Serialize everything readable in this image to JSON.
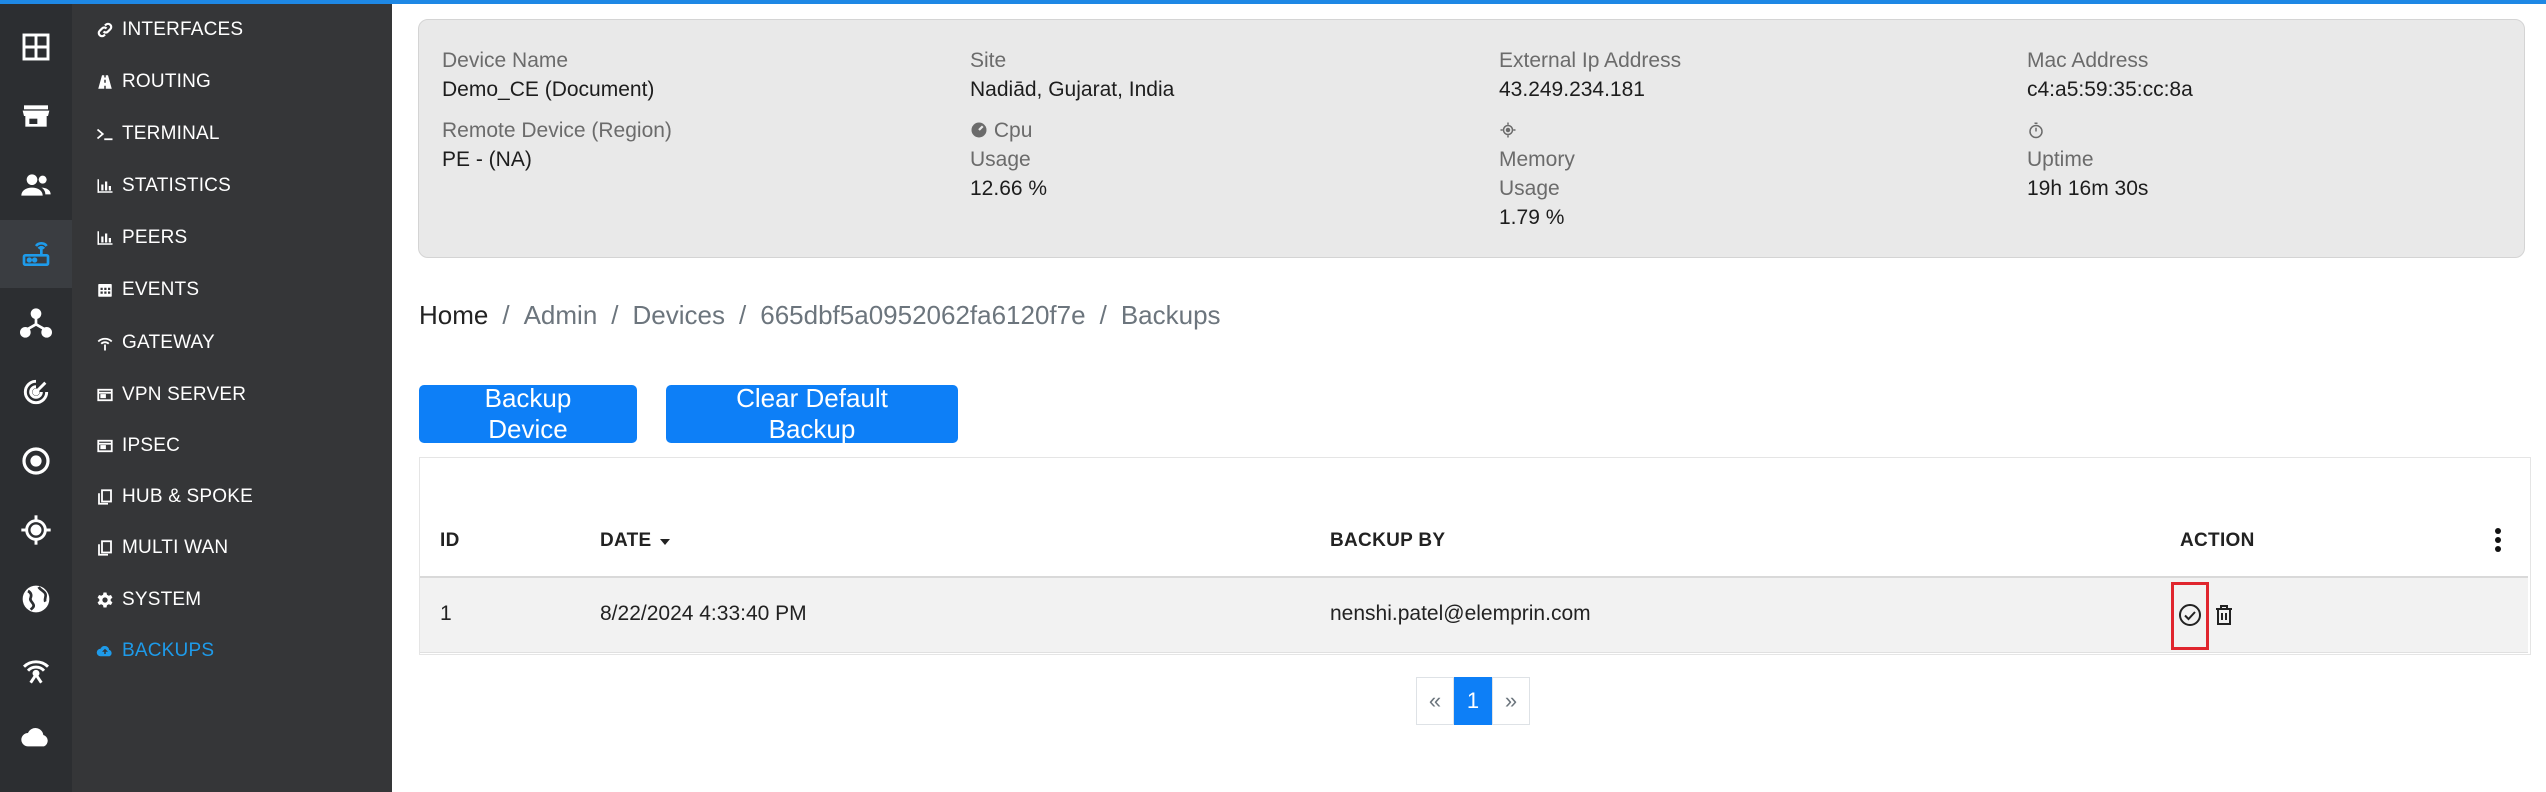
{
  "menu": {
    "items": [
      {
        "label": "INTERFACES",
        "icon": "link-icon"
      },
      {
        "label": "ROUTING",
        "icon": "road-icon"
      },
      {
        "label": "TERMINAL",
        "icon": "terminal-icon"
      },
      {
        "label": "STATISTICS",
        "icon": "bar-chart-icon"
      },
      {
        "label": "PEERS",
        "icon": "bar-chart-icon"
      },
      {
        "label": "EVENTS",
        "icon": "calendar-icon"
      },
      {
        "label": "GATEWAY",
        "icon": "antenna-icon"
      },
      {
        "label": "VPN SERVER",
        "icon": "window-icon"
      },
      {
        "label": "IPSEC",
        "icon": "window-icon"
      },
      {
        "label": "HUB & SPOKE",
        "icon": "copy-icon"
      },
      {
        "label": "MULTI WAN",
        "icon": "copy-icon"
      },
      {
        "label": "SYSTEM",
        "icon": "gear-icon"
      },
      {
        "label": "BACKUPS",
        "icon": "cloud-upload-icon"
      }
    ],
    "active": "BACKUPS"
  },
  "rail": {
    "icons": [
      "dashboard-grid-icon",
      "store-icon",
      "users-icon",
      "router-icon",
      "network-icon",
      "radar-icon",
      "target-icon",
      "crosshair-icon",
      "globe-icon",
      "wireless-tower-icon",
      "cloud-icon"
    ],
    "active_index": 3
  },
  "device_info": {
    "device_name_label": "Device Name",
    "device_name": "Demo_CE (Document)",
    "remote_label": "Remote Device (Region)",
    "remote_value": "PE - (NA)",
    "site_label": "Site",
    "site_value": "Nadiād, Gujarat, India",
    "cpu_label": "Cpu",
    "cpu_usage_label": "Usage",
    "cpu_value": "12.66 %",
    "external_ip_label": "External Ip Address",
    "external_ip": "43.249.234.181",
    "memory_label": "Memory",
    "memory_usage_label": "Usage",
    "memory_value": "1.79 %",
    "mac_label": "Mac Address",
    "mac_value": "c4:a5:59:35:cc:8a",
    "uptime_label": "Uptime",
    "uptime_value": "19h 16m 30s"
  },
  "breadcrumb": {
    "items": [
      "Home",
      "Admin",
      "Devices",
      "665dbf5a0952062fa6120f7e",
      "Backups"
    ],
    "separator": "/"
  },
  "buttons": {
    "backup_device": "Backup Device",
    "clear_default_backup": "Clear Default Backup"
  },
  "table": {
    "columns": {
      "id": "ID",
      "date": "DATE",
      "backup_by": "BACKUP BY",
      "action": "ACTION"
    },
    "sort_column": "DATE",
    "rows": [
      {
        "id": "1",
        "date": "8/22/2024 4:33:40 PM",
        "backup_by": "nenshi.patel@elemprin.com"
      }
    ]
  },
  "pagination": {
    "prev": "«",
    "current": "1",
    "next": "»"
  },
  "colors": {
    "accent": "#0d7ff7",
    "menu_active": "#1e9bea",
    "highlight_box": "#e0262e"
  }
}
